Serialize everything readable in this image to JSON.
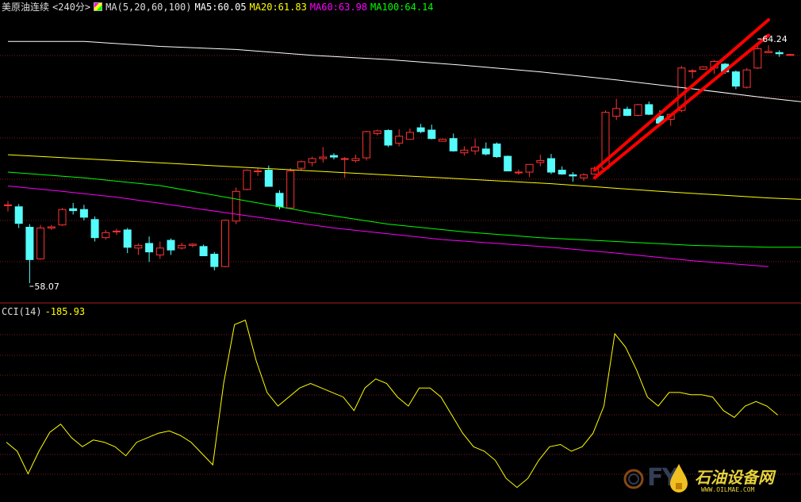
{
  "header": {
    "symbol": "美原油连续",
    "period": "<240分>",
    "ma_label": "MA(5,20,60,100)",
    "ma5": "MA5:60.05",
    "ma20": "MA20:61.83",
    "ma60": "MA60:63.98",
    "ma100": "MA100:64.14"
  },
  "cci_header": {
    "label": "CCI(14)",
    "value": "-185.93"
  },
  "watermark": {
    "letters": "FY",
    "text_cn": "石油设备网",
    "url": "WWW.OILMAE.COM"
  },
  "colors": {
    "up": "#ff3232",
    "down": "#54fcfc",
    "ma5": "#ffffff",
    "ma20": "#ffff00",
    "ma60": "#ff00ff",
    "ma100": "#00ff00",
    "cci": "#ffff00",
    "trendline": "#ff0000"
  },
  "chart_data": [
    {
      "type": "candlestick",
      "y_axis_range": [
        57.7,
        64.9
      ],
      "grid": true,
      "annotations": [
        {
          "text": "64.24",
          "candle": 69,
          "price": 64.24
        },
        {
          "text": "58.07",
          "candle": 2,
          "price": 58.07
        }
      ],
      "ohlc": [
        [
          60.08,
          60.2,
          59.93,
          60.1
        ],
        [
          60.05,
          60.12,
          59.5,
          59.62
        ],
        [
          59.52,
          59.6,
          58.07,
          58.68
        ],
        [
          58.7,
          59.58,
          58.68,
          59.5
        ],
        [
          59.5,
          59.58,
          59.45,
          59.53
        ],
        [
          59.58,
          60.02,
          59.55,
          59.98
        ],
        [
          60.0,
          60.15,
          59.85,
          59.95
        ],
        [
          59.98,
          60.1,
          59.7,
          59.78
        ],
        [
          59.72,
          59.8,
          59.15,
          59.25
        ],
        [
          59.25,
          59.45,
          59.2,
          59.38
        ],
        [
          59.4,
          59.48,
          59.32,
          59.42
        ],
        [
          59.45,
          59.5,
          58.85,
          59.0
        ],
        [
          58.98,
          59.1,
          58.8,
          59.05
        ],
        [
          59.1,
          59.28,
          58.62,
          58.88
        ],
        [
          58.8,
          59.15,
          58.7,
          58.98
        ],
        [
          59.18,
          59.23,
          58.8,
          58.93
        ],
        [
          58.98,
          59.12,
          58.94,
          59.05
        ],
        [
          59.05,
          59.1,
          59.0,
          59.08
        ],
        [
          59.02,
          59.07,
          58.78,
          58.78
        ],
        [
          58.82,
          58.88,
          58.4,
          58.5
        ],
        [
          58.5,
          59.72,
          58.48,
          59.7
        ],
        [
          59.68,
          60.55,
          59.6,
          60.45
        ],
        [
          60.5,
          61.02,
          60.48,
          61.0
        ],
        [
          60.98,
          61.05,
          60.85,
          60.98
        ],
        [
          61.0,
          61.12,
          60.58,
          60.58
        ],
        [
          60.4,
          60.48,
          59.98,
          60.05
        ],
        [
          60.02,
          61.05,
          60.0,
          60.98
        ],
        [
          61.05,
          61.25,
          61.0,
          61.22
        ],
        [
          61.2,
          61.35,
          61.1,
          61.3
        ],
        [
          61.3,
          61.6,
          61.2,
          61.34
        ],
        [
          61.38,
          61.44,
          61.28,
          61.34
        ],
        [
          61.29,
          61.34,
          60.8,
          61.3
        ],
        [
          61.25,
          61.4,
          61.2,
          61.3
        ],
        [
          61.32,
          62.02,
          61.25,
          62.0
        ],
        [
          61.95,
          62.05,
          61.9,
          62.02
        ],
        [
          62.03,
          62.06,
          61.6,
          61.65
        ],
        [
          61.7,
          62.06,
          61.62,
          61.88
        ],
        [
          61.8,
          62.08,
          61.8,
          61.98
        ],
        [
          62.1,
          62.2,
          61.96,
          62.0
        ],
        [
          62.04,
          62.18,
          61.8,
          61.82
        ],
        [
          61.75,
          61.82,
          61.75,
          61.8
        ],
        [
          61.82,
          61.95,
          61.48,
          61.5
        ],
        [
          61.45,
          61.62,
          61.38,
          61.52
        ],
        [
          61.5,
          61.82,
          61.4,
          61.6
        ],
        [
          61.55,
          61.72,
          61.38,
          61.42
        ],
        [
          61.68,
          61.72,
          61.32,
          61.35
        ],
        [
          61.36,
          61.38,
          60.98,
          60.98
        ],
        [
          60.95,
          61.02,
          60.88,
          60.95
        ],
        [
          60.95,
          61.15,
          60.82,
          61.15
        ],
        [
          61.2,
          61.4,
          61.1,
          61.25
        ],
        [
          61.3,
          61.42,
          60.9,
          60.95
        ],
        [
          61.0,
          61.1,
          60.88,
          60.9
        ],
        [
          60.88,
          60.95,
          60.7,
          60.85
        ],
        [
          60.8,
          60.92,
          60.72,
          60.88
        ],
        [
          60.9,
          61.1,
          60.88,
          61.05
        ],
        [
          61.05,
          62.55,
          61.0,
          62.5
        ],
        [
          62.4,
          62.85,
          62.3,
          62.6
        ],
        [
          62.58,
          62.65,
          62.4,
          62.42
        ],
        [
          62.42,
          62.72,
          62.4,
          62.7
        ],
        [
          62.7,
          62.78,
          62.43,
          62.45
        ],
        [
          62.4,
          62.55,
          62.2,
          62.22
        ],
        [
          62.32,
          62.45,
          62.15,
          62.45
        ],
        [
          62.55,
          63.7,
          62.5,
          63.65
        ],
        [
          63.58,
          63.62,
          63.38,
          63.58
        ],
        [
          63.62,
          63.7,
          63.6,
          63.68
        ],
        [
          63.65,
          63.85,
          63.5,
          63.82
        ],
        [
          63.75,
          63.78,
          63.5,
          63.55
        ],
        [
          63.55,
          63.59,
          63.1,
          63.18
        ],
        [
          63.15,
          63.65,
          63.12,
          63.6
        ],
        [
          63.65,
          64.24,
          63.62,
          64.15
        ],
        [
          64.05,
          64.24,
          64.05,
          64.08
        ],
        [
          64.05,
          64.11,
          63.94,
          64.02
        ],
        [
          64.0,
          64.02,
          64.0,
          64.0
        ]
      ],
      "ma5": [
        [
          0,
          64.34
        ],
        [
          7,
          64.34
        ],
        [
          14,
          64.21
        ],
        [
          21,
          64.13
        ],
        [
          28,
          63.98
        ],
        [
          35,
          63.87
        ],
        [
          42,
          63.72
        ],
        [
          49,
          63.55
        ],
        [
          56,
          63.34
        ],
        [
          63,
          63.11
        ],
        [
          70,
          62.87
        ],
        [
          77,
          62.65
        ]
      ],
      "ma20": [
        [
          0,
          61.4
        ],
        [
          10,
          61.25
        ],
        [
          20,
          61.1
        ],
        [
          30,
          60.95
        ],
        [
          40,
          60.8
        ],
        [
          50,
          60.65
        ],
        [
          60,
          60.45
        ],
        [
          70,
          60.28
        ],
        [
          80,
          60.16
        ],
        [
          90,
          60.02
        ]
      ],
      "ma60": [
        [
          0,
          60.59
        ],
        [
          5,
          60.45
        ],
        [
          10,
          60.3
        ],
        [
          15,
          60.1
        ],
        [
          20,
          59.9
        ],
        [
          25,
          59.7
        ],
        [
          30,
          59.5
        ],
        [
          40,
          59.2
        ],
        [
          50,
          59.0
        ],
        [
          56,
          58.85
        ],
        [
          63,
          58.65
        ],
        [
          70,
          58.5
        ]
      ],
      "ma100": [
        [
          0,
          60.95
        ],
        [
          7,
          60.8
        ],
        [
          14,
          60.6
        ],
        [
          21,
          60.25
        ],
        [
          28,
          59.9
        ],
        [
          35,
          59.6
        ],
        [
          42,
          59.4
        ],
        [
          49,
          59.25
        ],
        [
          56,
          59.15
        ],
        [
          63,
          59.05
        ],
        [
          70,
          59.0
        ],
        [
          77,
          59.0
        ]
      ],
      "trendlines": [
        {
          "from": [
            54,
            60.8
          ],
          "to": [
            70,
            64.5
          ]
        },
        {
          "from": [
            54,
            61.0
          ],
          "to": [
            70,
            64.9
          ]
        }
      ]
    },
    {
      "type": "line",
      "name": "CCI(14)",
      "values": [
        -140,
        -160,
        -210,
        -160,
        -118,
        -100,
        -130,
        -150,
        -135,
        -140,
        -150,
        -170,
        -140,
        -130,
        -120,
        -115,
        -125,
        -140,
        -165,
        -190,
        -10,
        120,
        130,
        40,
        -30,
        -60,
        -40,
        -20,
        -10,
        -20,
        -30,
        -40,
        -70,
        -20,
        0,
        -10,
        -40,
        -60,
        -20,
        -20,
        -40,
        -80,
        -120,
        -150,
        -160,
        -180,
        -220,
        -240,
        -220,
        -180,
        -150,
        -145,
        -160,
        -150,
        -120,
        -60,
        100,
        70,
        20,
        -40,
        -60,
        -30,
        -30,
        -35,
        -35,
        -40,
        -70,
        -85,
        -60,
        -50,
        -60,
        -80
      ]
    }
  ]
}
